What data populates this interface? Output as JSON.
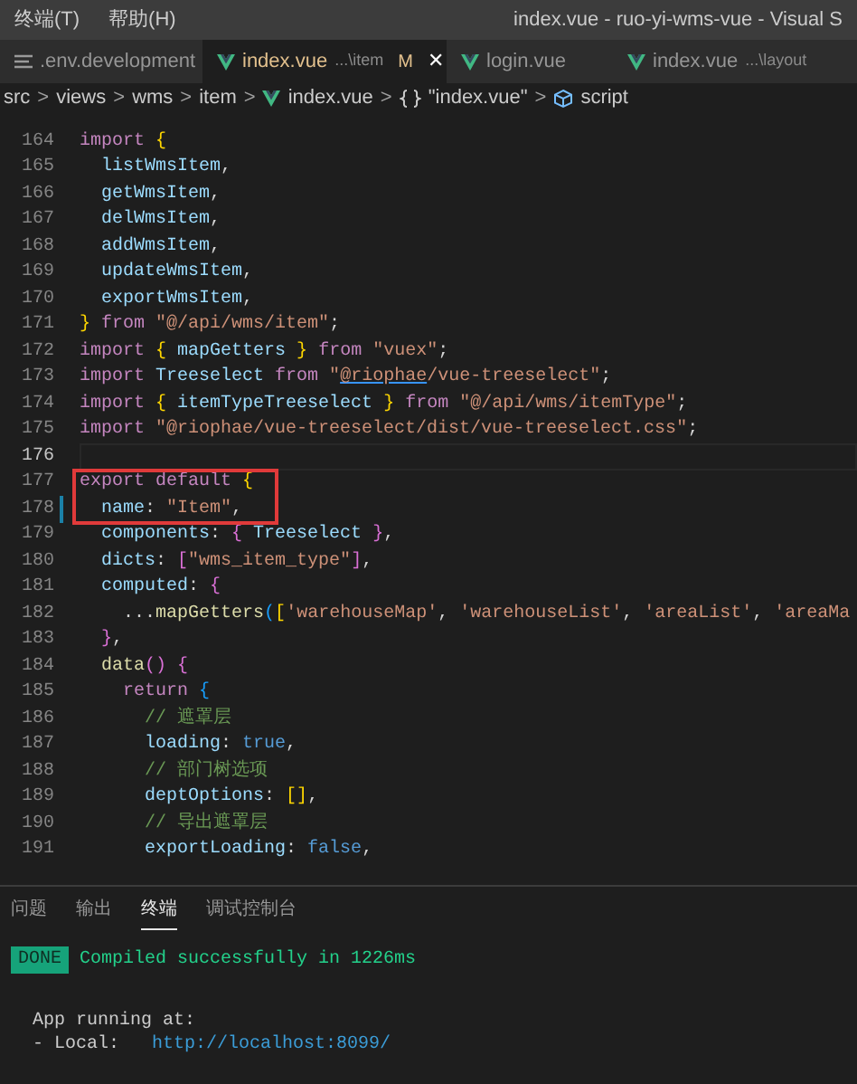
{
  "menu": [
    {
      "label": "终端(T)"
    },
    {
      "label": "帮助(H)"
    }
  ],
  "window": {
    "title": "index.vue - ruo-yi-wms-vue - Visual S"
  },
  "tabs": [
    {
      "label": ".env.development",
      "kind": "text",
      "selected": false,
      "modified": false
    },
    {
      "label": "index.vue",
      "description": "...\\item",
      "kind": "vue",
      "selected": true,
      "modified": true,
      "badge": "M",
      "close": "✕"
    },
    {
      "label": "login.vue",
      "kind": "vue",
      "selected": false,
      "modified": false
    },
    {
      "label": "index.vue",
      "description": "...\\layout",
      "kind": "vue",
      "selected": false,
      "modified": false
    }
  ],
  "breadcrumb": [
    {
      "label": "src",
      "kind": "folder"
    },
    {
      "label": "views",
      "kind": "folder"
    },
    {
      "label": "wms",
      "kind": "folder"
    },
    {
      "label": "item",
      "kind": "folder"
    },
    {
      "label": "index.vue",
      "kind": "vue"
    },
    {
      "label": "\"index.vue\"",
      "kind": "braces"
    },
    {
      "label": "script",
      "kind": "cube"
    }
  ],
  "breadcrumb_separator": ">",
  "code": [
    {
      "number": "164",
      "tokens": [
        {
          "kind": "kw",
          "text": "import "
        },
        {
          "kind": "b1",
          "text": "{"
        }
      ]
    },
    {
      "number": "165",
      "tokens": [
        {
          "kind": "var",
          "text": "  listWmsItem"
        },
        {
          "kind": "punct",
          "text": ","
        }
      ]
    },
    {
      "number": "166",
      "tokens": [
        {
          "kind": "var",
          "text": "  getWmsItem"
        },
        {
          "kind": "punct",
          "text": ","
        }
      ]
    },
    {
      "number": "167",
      "tokens": [
        {
          "kind": "var",
          "text": "  delWmsItem"
        },
        {
          "kind": "punct",
          "text": ","
        }
      ]
    },
    {
      "number": "168",
      "tokens": [
        {
          "kind": "var",
          "text": "  addWmsItem"
        },
        {
          "kind": "punct",
          "text": ","
        }
      ]
    },
    {
      "number": "169",
      "tokens": [
        {
          "kind": "var",
          "text": "  updateWmsItem"
        },
        {
          "kind": "punct",
          "text": ","
        }
      ]
    },
    {
      "number": "170",
      "tokens": [
        {
          "kind": "var",
          "text": "  exportWmsItem"
        },
        {
          "kind": "punct",
          "text": ","
        }
      ]
    },
    {
      "number": "171",
      "tokens": [
        {
          "kind": "b1",
          "text": "}"
        },
        {
          "kind": "kw",
          "text": " from "
        },
        {
          "kind": "str",
          "text": "\"@/api/wms/item\""
        },
        {
          "kind": "punct",
          "text": ";"
        }
      ]
    },
    {
      "number": "172",
      "tokens": [
        {
          "kind": "kw",
          "text": "import "
        },
        {
          "kind": "b1",
          "text": "{"
        },
        {
          "kind": "var",
          "text": " mapGetters "
        },
        {
          "kind": "b1",
          "text": "}"
        },
        {
          "kind": "kw",
          "text": " from "
        },
        {
          "kind": "str",
          "text": "\"vuex\""
        },
        {
          "kind": "punct",
          "text": ";"
        }
      ]
    },
    {
      "number": "173",
      "tokens": [
        {
          "kind": "kw",
          "text": "import "
        },
        {
          "kind": "var",
          "text": "Treeselect "
        },
        {
          "kind": "kw",
          "text": "from "
        },
        {
          "kind": "str",
          "text": "\""
        },
        {
          "kind": "link",
          "text": "@riophae"
        },
        {
          "kind": "str",
          "text": "/vue-treeselect\""
        },
        {
          "kind": "punct",
          "text": ";"
        }
      ]
    },
    {
      "number": "174",
      "tokens": [
        {
          "kind": "kw",
          "text": "import "
        },
        {
          "kind": "b1",
          "text": "{"
        },
        {
          "kind": "var",
          "text": " itemTypeTreeselect "
        },
        {
          "kind": "b1",
          "text": "}"
        },
        {
          "kind": "kw",
          "text": " from "
        },
        {
          "kind": "str",
          "text": "\"@/api/wms/itemType\""
        },
        {
          "kind": "punct",
          "text": ";"
        }
      ]
    },
    {
      "number": "175",
      "tokens": [
        {
          "kind": "kw",
          "text": "import "
        },
        {
          "kind": "str",
          "text": "\"@riophae/vue-treeselect/dist/vue-treeselect.css\""
        },
        {
          "kind": "punct",
          "text": ";"
        }
      ]
    },
    {
      "number": "176",
      "current": true
    },
    {
      "number": "177",
      "boxed": true,
      "tokens": [
        {
          "kind": "kw",
          "text": "export default "
        },
        {
          "kind": "b1",
          "text": "{"
        }
      ]
    },
    {
      "number": "178",
      "boxed": true,
      "modified": true,
      "tokens": [
        {
          "kind": "var",
          "text": "  name"
        },
        {
          "kind": "punct",
          "text": ": "
        },
        {
          "kind": "str",
          "text": "\"Item\""
        },
        {
          "kind": "punct",
          "text": ","
        }
      ]
    },
    {
      "number": "179",
      "tokens": [
        {
          "kind": "var",
          "text": "  components"
        },
        {
          "kind": "punct",
          "text": ": "
        },
        {
          "kind": "b2",
          "text": "{"
        },
        {
          "kind": "var",
          "text": " Treeselect "
        },
        {
          "kind": "b2",
          "text": "}"
        },
        {
          "kind": "punct",
          "text": ","
        }
      ]
    },
    {
      "number": "180",
      "tokens": [
        {
          "kind": "var",
          "text": "  dicts"
        },
        {
          "kind": "punct",
          "text": ": "
        },
        {
          "kind": "b2",
          "text": "["
        },
        {
          "kind": "str",
          "text": "\"wms_item_type\""
        },
        {
          "kind": "b2",
          "text": "]"
        },
        {
          "kind": "punct",
          "text": ","
        }
      ]
    },
    {
      "number": "181",
      "tokens": [
        {
          "kind": "var",
          "text": "  computed"
        },
        {
          "kind": "punct",
          "text": ": "
        },
        {
          "kind": "b2",
          "text": "{"
        }
      ]
    },
    {
      "number": "182",
      "tokens": [
        {
          "kind": "punct",
          "text": "    ..."
        },
        {
          "kind": "fn",
          "text": "mapGetters"
        },
        {
          "kind": "b3",
          "text": "("
        },
        {
          "kind": "b1",
          "text": "["
        },
        {
          "kind": "str",
          "text": "'warehouseMap'"
        },
        {
          "kind": "punct",
          "text": ", "
        },
        {
          "kind": "str",
          "text": "'warehouseList'"
        },
        {
          "kind": "punct",
          "text": ", "
        },
        {
          "kind": "str",
          "text": "'areaList'"
        },
        {
          "kind": "punct",
          "text": ", "
        },
        {
          "kind": "str",
          "text": "'areaMa"
        }
      ]
    },
    {
      "number": "183",
      "tokens": [
        {
          "kind": "b2",
          "text": "  }"
        },
        {
          "kind": "punct",
          "text": ","
        }
      ]
    },
    {
      "number": "184",
      "tokens": [
        {
          "kind": "fn",
          "text": "  data"
        },
        {
          "kind": "b2",
          "text": "() {"
        }
      ]
    },
    {
      "number": "185",
      "tokens": [
        {
          "kind": "kw",
          "text": "    return "
        },
        {
          "kind": "b3",
          "text": "{"
        }
      ]
    },
    {
      "number": "186",
      "tokens": [
        {
          "kind": "comment",
          "text": "      // 遮罩层"
        }
      ]
    },
    {
      "number": "187",
      "tokens": [
        {
          "kind": "var",
          "text": "      loading"
        },
        {
          "kind": "punct",
          "text": ": "
        },
        {
          "kind": "const",
          "text": "true"
        },
        {
          "kind": "punct",
          "text": ","
        }
      ]
    },
    {
      "number": "188",
      "tokens": [
        {
          "kind": "comment",
          "text": "      // 部门树选项"
        }
      ]
    },
    {
      "number": "189",
      "tokens": [
        {
          "kind": "var",
          "text": "      deptOptions"
        },
        {
          "kind": "punct",
          "text": ": "
        },
        {
          "kind": "b1",
          "text": "[]"
        },
        {
          "kind": "punct",
          "text": ","
        }
      ]
    },
    {
      "number": "190",
      "tokens": [
        {
          "kind": "comment",
          "text": "      // 导出遮罩层"
        }
      ]
    },
    {
      "number": "191",
      "tokens": [
        {
          "kind": "var",
          "text": "      exportLoading"
        },
        {
          "kind": "punct",
          "text": ": "
        },
        {
          "kind": "const",
          "text": "false"
        },
        {
          "kind": "punct",
          "text": ","
        }
      ]
    }
  ],
  "panel_tabs": [
    {
      "label": "问题",
      "selected": false
    },
    {
      "label": "输出",
      "selected": false
    },
    {
      "label": "终端",
      "selected": true
    },
    {
      "label": "调试控制台",
      "selected": false
    }
  ],
  "terminal": [
    {
      "kind": "status",
      "badge": "DONE",
      "text": "Compiled successfully in 1226ms"
    },
    {
      "kind": "blank"
    },
    {
      "kind": "plain",
      "text": "  App running at:"
    },
    {
      "kind": "url",
      "text": "  - Local:   ",
      "url": "http://localhost:8099/"
    }
  ]
}
